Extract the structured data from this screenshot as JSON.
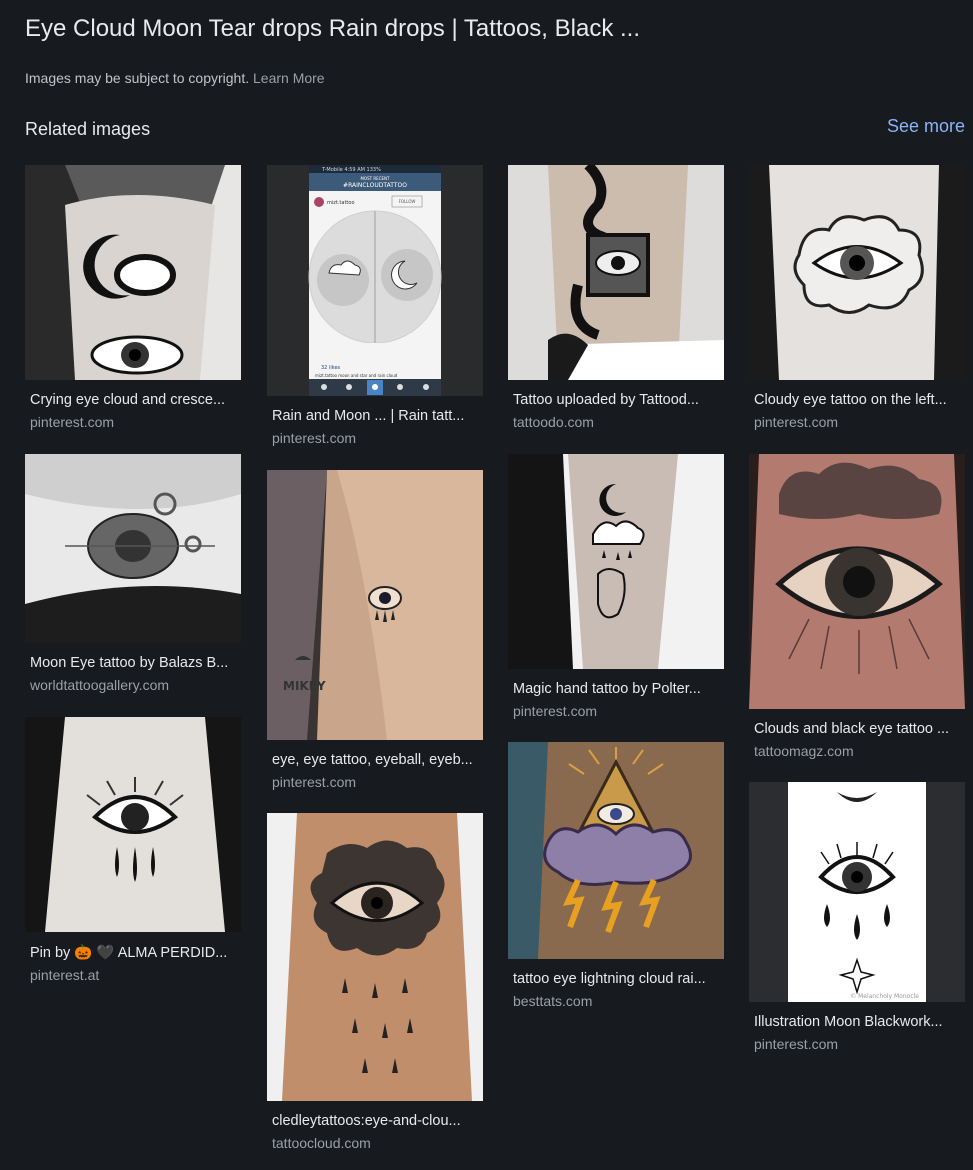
{
  "header": {
    "title": "Eye Cloud Moon Tear drops Rain drops | Tattoos, Black ...",
    "copyright_text": "Images may be subject to copyright.",
    "learn_more": "Learn More",
    "related_label": "Related images",
    "see_more": "See more"
  },
  "results": [
    {
      "title": "Crying eye cloud and cresce...",
      "source": "pinterest.com"
    },
    {
      "title": "Rain and Moon ... | Rain tatt...",
      "source": "pinterest.com"
    },
    {
      "title": "Tattoo uploaded by Tattood...",
      "source": "tattoodo.com"
    },
    {
      "title": "Cloudy eye tattoo on the left...",
      "source": "pinterest.com"
    },
    {
      "title": "Moon Eye tattoo by Balazs B...",
      "source": "worldtattoogallery.com"
    },
    {
      "title": "eye, eye tattoo, eyeball, eyeb...",
      "source": "pinterest.com"
    },
    {
      "title": "Magic hand tattoo by Polter...",
      "source": "pinterest.com"
    },
    {
      "title": "Clouds and black eye tattoo ...",
      "source": "tattoomagz.com"
    },
    {
      "title": "Pin by 🎃 🖤 ALMA PERDID...",
      "source": "pinterest.at"
    },
    {
      "title": "cledleytattoos:eye-and-clou...",
      "source": "tattoocloud.com"
    },
    {
      "title": "tattoo eye lightning cloud rai...",
      "source": "besttats.com"
    },
    {
      "title": "Illustration Moon Blackwork...",
      "source": "pinterest.com"
    }
  ],
  "phone_screenshot": {
    "status": "T-Mobile   4:59 AM   133%",
    "most_recent": "MOST RECENT",
    "hashtag": "#RAINCLOUDTATTOO",
    "user": "mizt.tattoo",
    "follow": "FOLLOW",
    "likes": "32 likes",
    "caption": "mizt.tattoo moon and star and rain cloud"
  },
  "watermarks": {
    "mikey": "MIKEY",
    "signature": "© Melancholy Monocle"
  }
}
